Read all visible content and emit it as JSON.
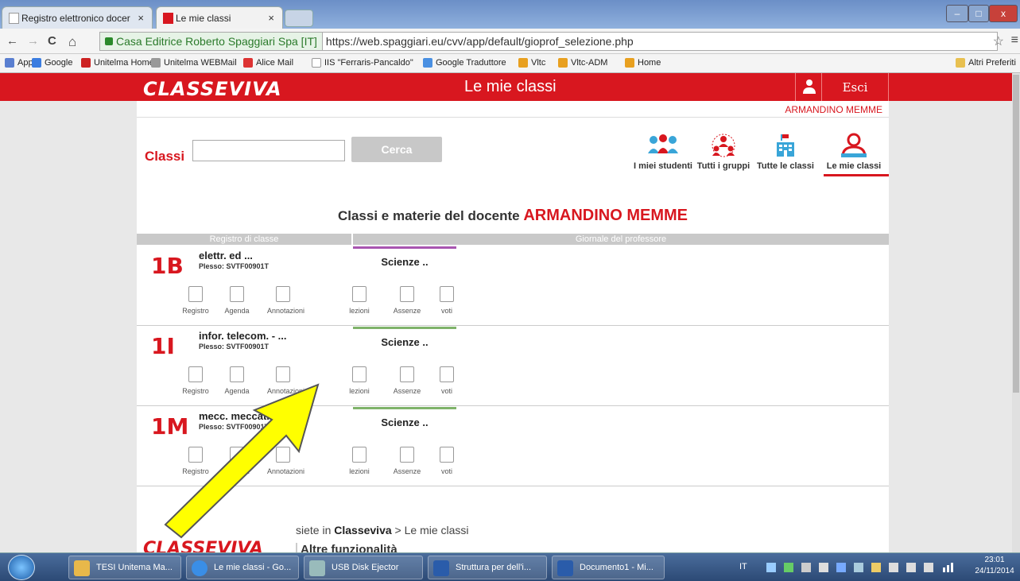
{
  "browser": {
    "tabs": [
      {
        "label": "Registro elettronico docer",
        "active": false
      },
      {
        "label": "Le mie classi",
        "active": true
      }
    ],
    "close_glyph": "×",
    "window_controls": {
      "minimize": "–",
      "maximize": "□",
      "close": "x"
    },
    "nav": {
      "back": "←",
      "forward": "→",
      "reload": "C",
      "home": "⌂"
    },
    "address": {
      "secure_label": "Casa Editrice Roberto Spaggiari Spa [IT]",
      "url": "https://web.spaggiari.eu/cvv/app/default/gioprof_selezione.php"
    },
    "star": "☆",
    "menu": "≡",
    "bookmarks": [
      {
        "label": "App"
      },
      {
        "label": "Google"
      },
      {
        "label": "Unitelma Home"
      },
      {
        "label": "Unitelma WEBMail"
      },
      {
        "label": "Alice Mail"
      },
      {
        "label": "IIS \"Ferraris-Pancaldo\""
      },
      {
        "label": "Google Traduttore"
      },
      {
        "label": "Vltc"
      },
      {
        "label": "Vltc-ADM"
      },
      {
        "label": "Home"
      }
    ],
    "other_bookmarks": "Altri Preferiti"
  },
  "header": {
    "logo": "CLASSEVIVA",
    "title": "Le mie classi",
    "logout": "Esci",
    "username": "ARMANDINO MEMME"
  },
  "search": {
    "label": "Classi",
    "value": "",
    "button": "Cerca"
  },
  "top_nav": [
    {
      "label": "I miei studenti",
      "icon": "students-icon"
    },
    {
      "label": "Tutti i gruppi",
      "icon": "groups-icon"
    },
    {
      "label": "Tutte le classi",
      "icon": "school-building-icon"
    },
    {
      "label": "Le mie classi",
      "icon": "teacher-icon",
      "active": true
    }
  ],
  "main": {
    "heading_prefix": "Classi e materie del docente",
    "heading_name": "ARMANDINO MEMME",
    "col_registro": "Registro di classe",
    "col_giornale": "Giornale del professore",
    "classes": [
      {
        "code": "1B",
        "subject": "elettr. ed ...",
        "plesso": "Plesso: SVTF00901T",
        "materia": "Scienze ..",
        "bar_color": "#a855b0"
      },
      {
        "code": "1I",
        "subject": "infor. telecom. - ...",
        "plesso": "Plesso: SVTF00901T",
        "materia": "Scienze ..",
        "bar_color": "#7fb36a"
      },
      {
        "code": "1M",
        "subject": "mecc. meccatron. ...",
        "plesso": "Plesso: SVTF00901T",
        "materia": "Scienze ..",
        "bar_color": "#7fb36a"
      }
    ],
    "actions": [
      "Registro",
      "Agenda",
      "Annotazioni",
      "lezioni",
      "Assenze",
      "voti"
    ]
  },
  "footer": {
    "location_prefix": "siete in",
    "location_app": "Classeviva",
    "location_suffix": "> Le mie classi",
    "more": "Altre funzionalità",
    "logo": "CLASSEVIVA"
  },
  "taskbar": {
    "items": [
      {
        "label": "TESI Unitema Ma...",
        "color": "#e8b84a"
      },
      {
        "label": "Le mie classi - Go...",
        "color": "#3a8ee6"
      },
      {
        "label": "USB Disk Ejector",
        "color": "#9bb"
      },
      {
        "label": "Struttura per dell'i...",
        "color": "#2a5caa"
      },
      {
        "label": "Documento1 - Mi...",
        "color": "#2a5caa"
      }
    ],
    "lang": "IT",
    "time": "23:01",
    "date": "24/11/2014"
  }
}
